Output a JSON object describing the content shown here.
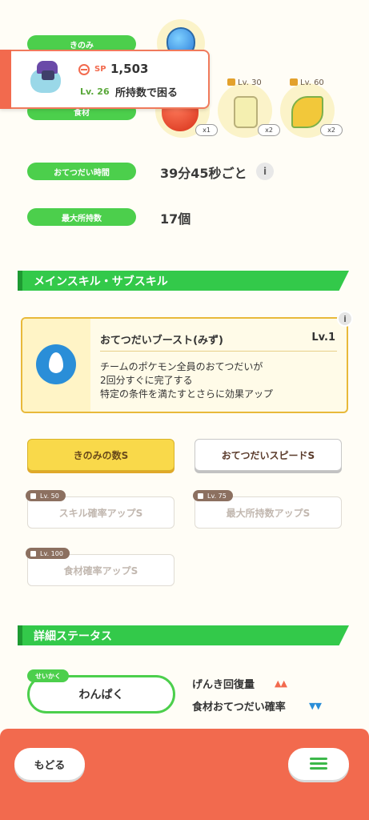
{
  "pills": {
    "berry": "きのみ",
    "ingredient": "食材",
    "help_time": "おてつだい時間",
    "max_carry": "最大所持数"
  },
  "popup": {
    "sp_label": "SP",
    "sp_value": "1,503",
    "level": "Lv. 26",
    "status": "所持数で困る"
  },
  "ingredients": [
    {
      "lv": "",
      "count": "x1"
    },
    {
      "lv": "Lv. 30",
      "count": "x2"
    },
    {
      "lv": "Lv. 60",
      "count": "x2"
    }
  ],
  "help_time": "39分45秒ごと",
  "max_carry": "17個",
  "skills_section": "メインスキル・サブスキル",
  "main_skill": {
    "name": "おてつだいブースト(みず)",
    "level": "Lv.1",
    "desc1": "チームのポケモン全員のおてつだいが",
    "desc2": "2回分すぐに完了する",
    "desc3": "特定の条件を満たすとさらに効果アップ"
  },
  "sub_skills": [
    {
      "label": "きのみの数S",
      "lv": ""
    },
    {
      "label": "おてつだいスピードS",
      "lv": ""
    },
    {
      "label": "スキル確率アップS",
      "lv": "Lv. 50"
    },
    {
      "label": "最大所持数アップS",
      "lv": "Lv. 75"
    },
    {
      "label": "食材確率アップS",
      "lv": "Lv. 100"
    }
  ],
  "detail_section": "詳細ステータス",
  "nature": {
    "tag": "せいかく",
    "value": "わんぱく",
    "up_label": "げんき回復量",
    "down_label": "食材おてつだい確率"
  },
  "nav": {
    "back": "もどる"
  },
  "colors": {
    "green": "#4ccf4c",
    "orange": "#f26a4e",
    "yellow": "#f9d94a"
  }
}
